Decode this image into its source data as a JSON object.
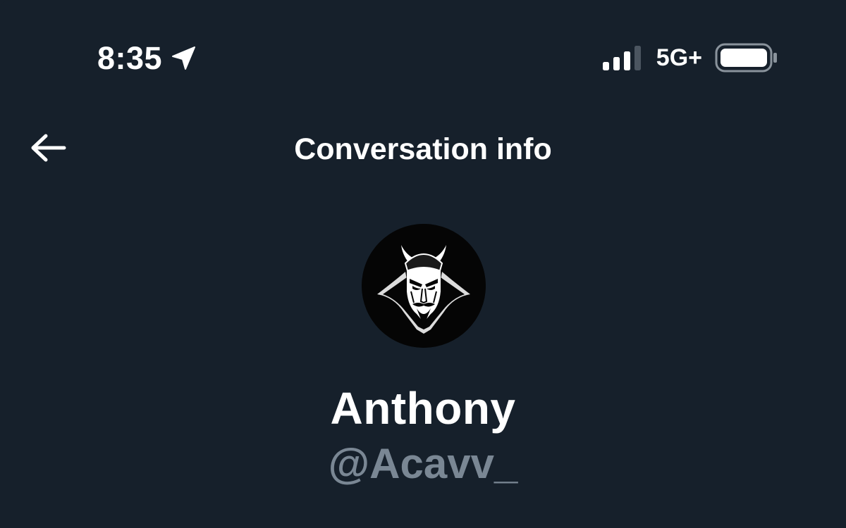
{
  "status_bar": {
    "time": "8:35",
    "location_icon": "location-arrow-icon",
    "signal_icon": "cellular-signal-icon",
    "network": "5G+",
    "battery_icon": "battery-icon"
  },
  "header": {
    "back_icon": "back-arrow-icon",
    "title": "Conversation info"
  },
  "profile": {
    "avatar_icon": "devil-avatar-icon",
    "display_name": "Anthony",
    "handle": "@Acavv_"
  },
  "colors": {
    "background": "#16202b",
    "primary_text": "#ffffff",
    "secondary_text": "#7a8794",
    "avatar_background": "#050505"
  }
}
